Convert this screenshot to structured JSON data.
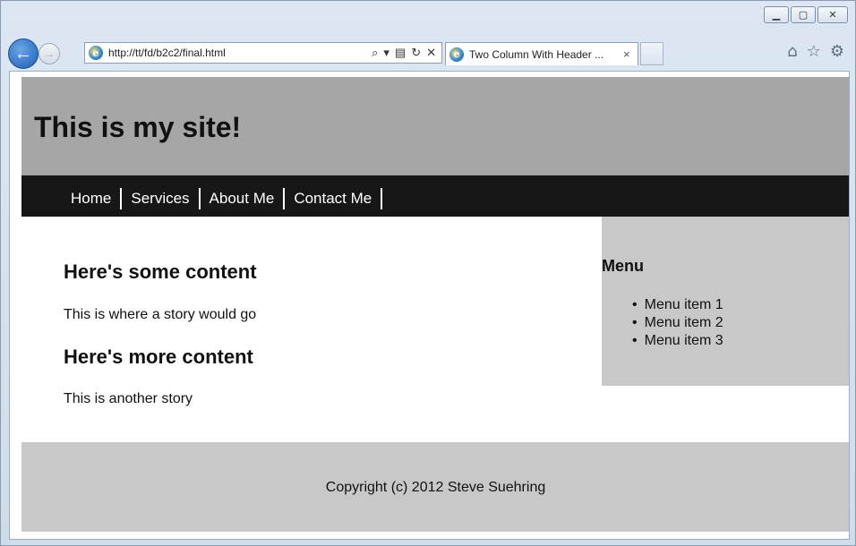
{
  "browser": {
    "address_url": "http://tt/fd/b2c2/final.html",
    "tab_title": "Two Column With Header ..."
  },
  "site": {
    "header_title": "This is my site!",
    "nav": [
      "Home",
      "Services",
      "About Me",
      "Contact Me"
    ],
    "content": {
      "heading1": "Here's some content",
      "para1": "This is where a story would go",
      "heading2": "Here's more content",
      "para2": "This is another story"
    },
    "sidebar": {
      "title": "Menu",
      "items": [
        "Menu item 1",
        "Menu item 2",
        "Menu item 3"
      ]
    },
    "footer": "Copyright (c) 2012 Steve Suehring"
  }
}
